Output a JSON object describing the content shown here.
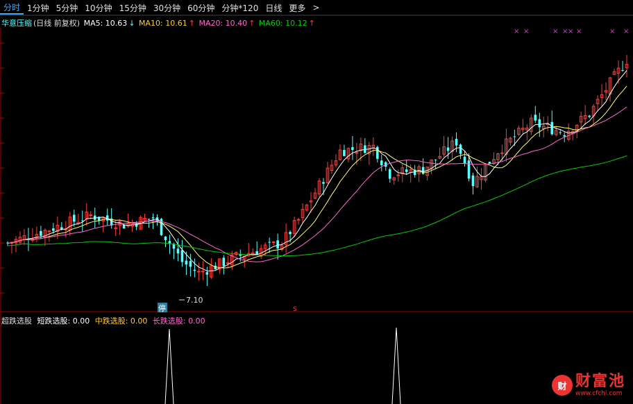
{
  "toolbar": {
    "tabs": [
      {
        "label": "分时",
        "active": true
      },
      {
        "label": "1分钟",
        "active": false
      },
      {
        "label": "5分钟",
        "active": false
      },
      {
        "label": "10分钟",
        "active": false
      },
      {
        "label": "15分钟",
        "active": false
      },
      {
        "label": "30分钟",
        "active": false
      },
      {
        "label": "60分钟",
        "active": false
      },
      {
        "label": "分钟*120",
        "active": false
      },
      {
        "label": "日线",
        "active": false
      },
      {
        "label": "更多",
        "active": false
      }
    ],
    "more_arrow": ">"
  },
  "legend": {
    "name": "华意压缩",
    "period": "(日线 前复权)",
    "ma5": "MA5: 10.63",
    "ma5_arrow": "↓",
    "ma10": "MA10: 10.61",
    "ma10_arrow": "↑",
    "ma20": "MA20: 10.40",
    "ma20_arrow": "↑",
    "ma60": "MA60: 10.12",
    "ma60_arrow": "↑"
  },
  "annotations": {
    "low_label": "7.10",
    "stop_badge": "停",
    "s_marker": "S",
    "top_marks": "×"
  },
  "sub_legend": {
    "name": "超跌选股",
    "short": "短跌选股: 0.00",
    "mid": "中跌选股: 0.00",
    "long": "长跌选股: 0.00"
  },
  "colors": {
    "up": "#ff3b3b",
    "down": "#54ffff",
    "ma5": "#ffffff",
    "ma10": "#ffff66",
    "ma20": "#ff66cc",
    "ma60": "#00cc00",
    "ma5_text": "#ffffff",
    "ma10_text": "#ffcc33",
    "ma20_text": "#ff66cc",
    "ma60_text": "#00cc00",
    "name_text": "#54ffff",
    "grid": "#550000"
  },
  "logo": {
    "icon": "财",
    "name": "财富池",
    "url": "www.cfchi.com"
  }
}
